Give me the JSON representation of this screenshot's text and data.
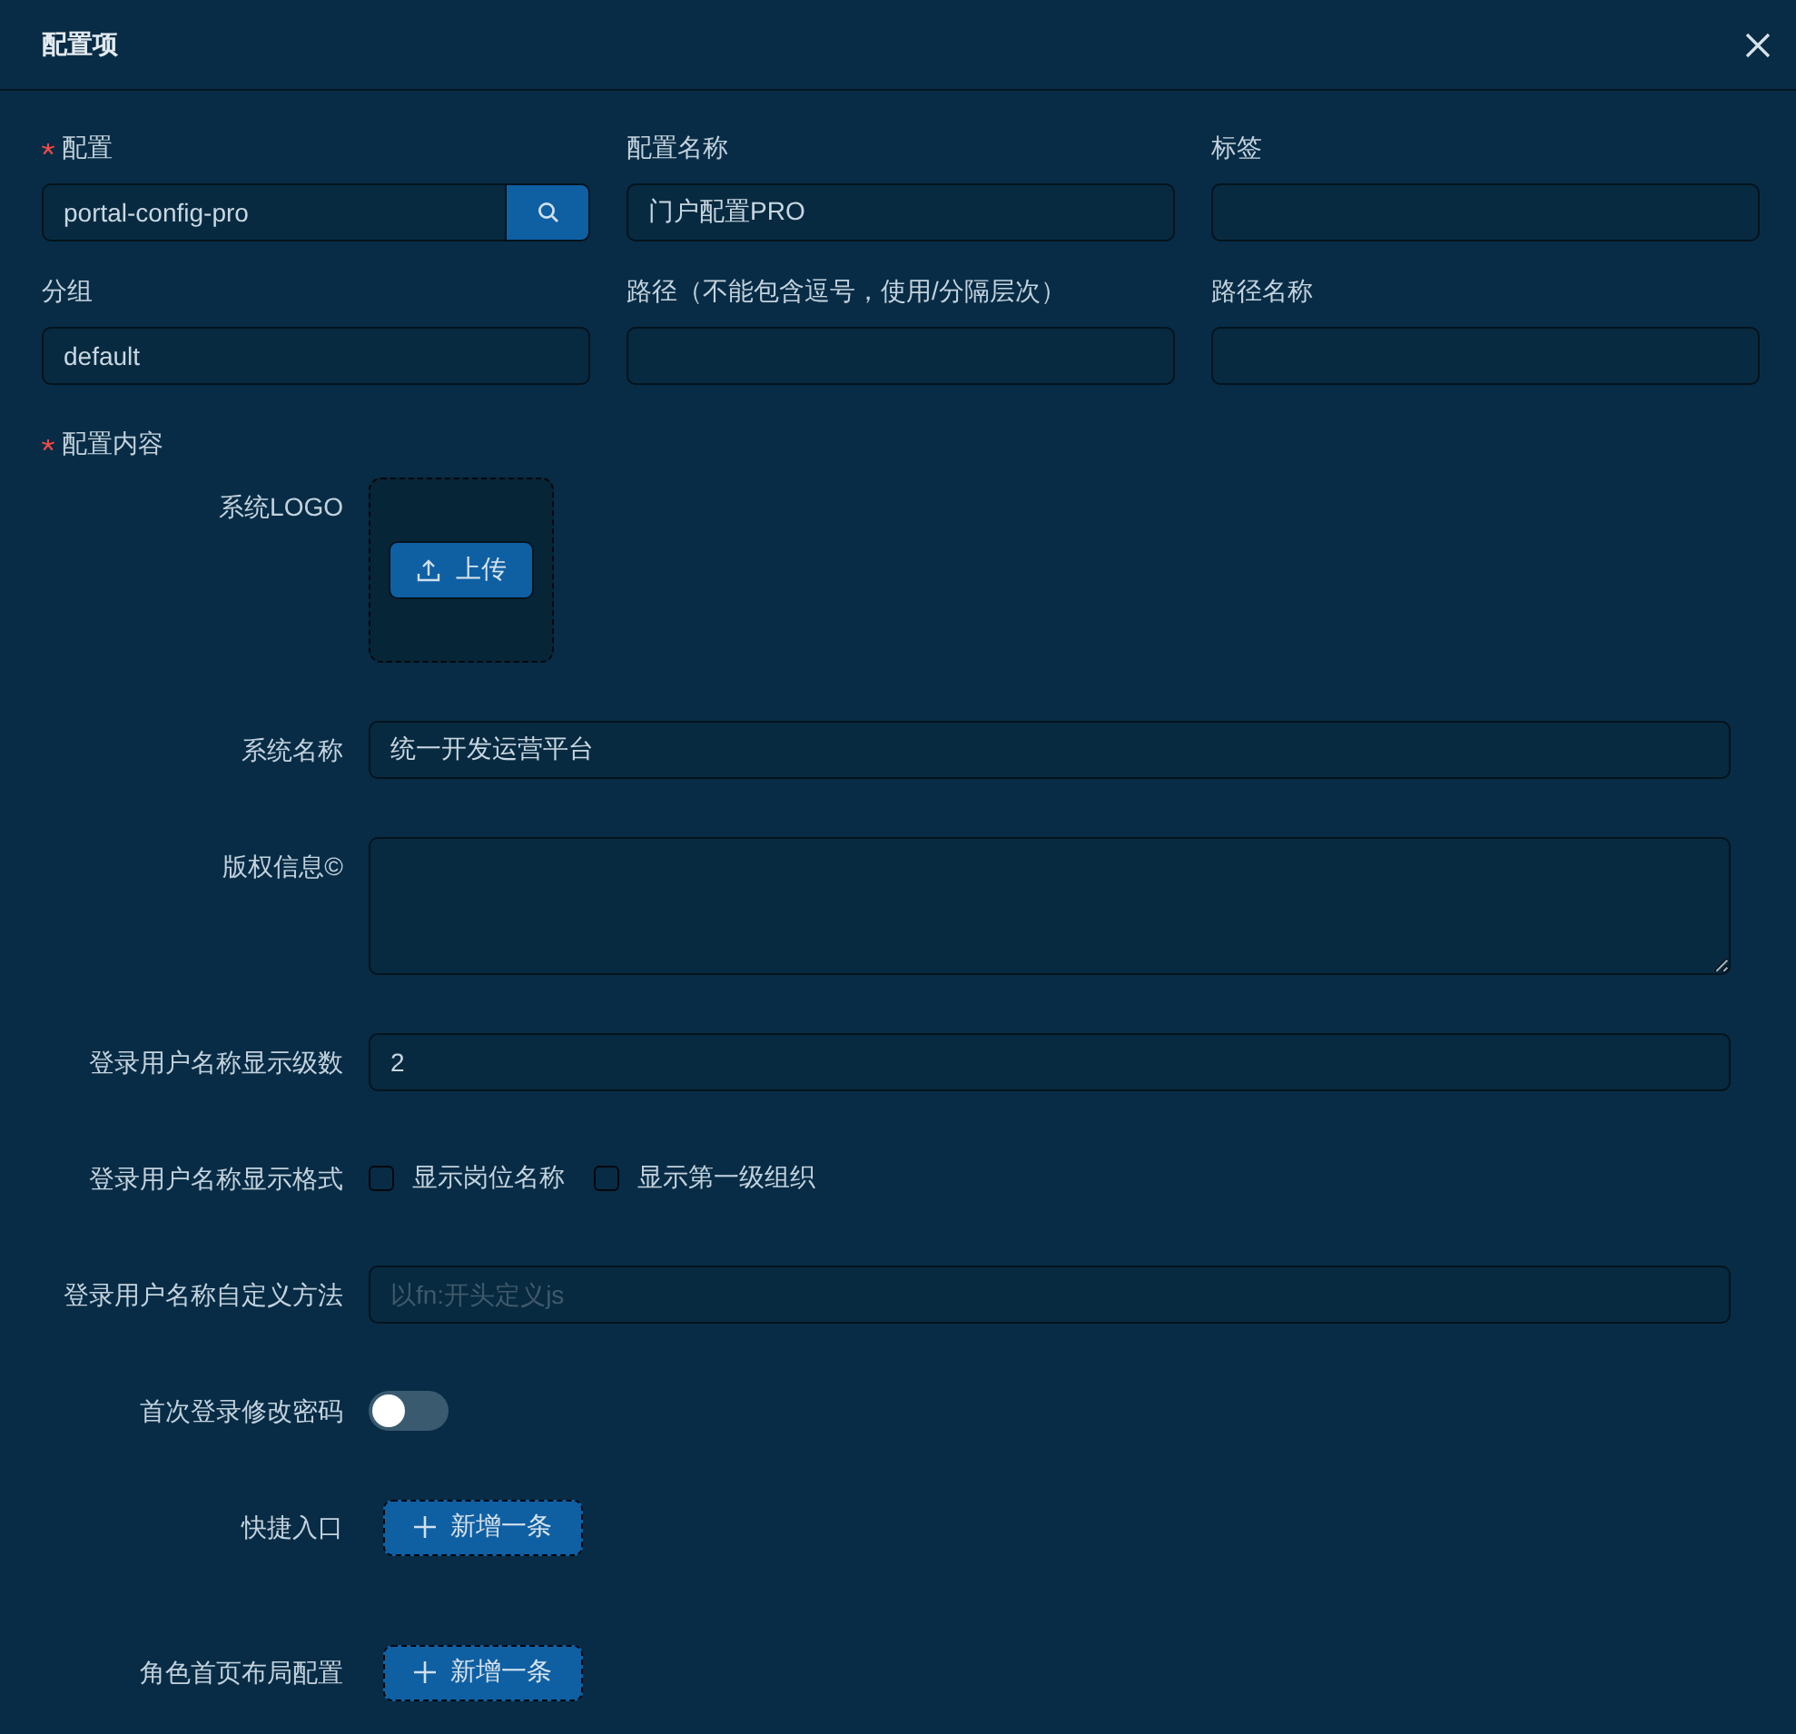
{
  "dialog": {
    "title": "配置项"
  },
  "fields": [
    {
      "label": "配置",
      "required": true,
      "kind": "search",
      "value": "portal-config-pro"
    },
    {
      "label": "配置名称",
      "required": false,
      "kind": "input",
      "value": "门户配置PRO"
    },
    {
      "label": "标签",
      "required": false,
      "kind": "input"
    },
    {
      "label": "分组",
      "required": false,
      "kind": "input",
      "value": "default"
    },
    {
      "label": "路径（不能包含逗号，使用/分隔层次）",
      "required": false,
      "kind": "input"
    },
    {
      "label": "路径名称",
      "required": false,
      "kind": "input"
    }
  ],
  "content": {
    "label": "配置内容",
    "required": true,
    "rows": [
      {
        "kind": "upload",
        "label": "系统LOGO",
        "button": "上传"
      },
      {
        "kind": "input",
        "label": "系统名称",
        "value": "统一开发运营平台"
      },
      {
        "kind": "textarea",
        "label": "版权信息©"
      },
      {
        "kind": "input",
        "label": "登录用户名称显示级数",
        "value": "2"
      },
      {
        "kind": "checkboxes",
        "label": "登录用户名称显示格式",
        "options": [
          {
            "label": "显示岗位名称",
            "checked": false
          },
          {
            "label": "显示第一级组织",
            "checked": false
          }
        ]
      },
      {
        "kind": "input",
        "label": "登录用户名称自定义方法",
        "placeholder": "以fn:开头定义js"
      },
      {
        "kind": "switch",
        "label": "首次登录修改密码",
        "on": false
      },
      {
        "kind": "add",
        "label": "快捷入口",
        "button": "新增一条"
      },
      {
        "kind": "add",
        "label": "角色首页布局配置",
        "button": "新增一条"
      }
    ]
  }
}
